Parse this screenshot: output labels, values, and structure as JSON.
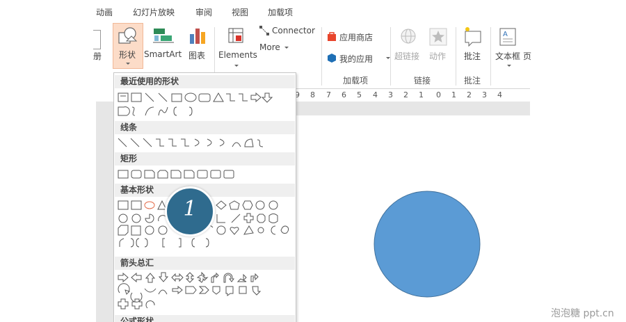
{
  "tabs": [
    "动画",
    "幻灯片放映",
    "审阅",
    "视图",
    "加载项"
  ],
  "ribbon": {
    "edge_label": "册",
    "shapes_button": "形状",
    "smartart_button": "SmartArt",
    "chart_button": "图表",
    "elements_button": "Elements",
    "connector_button": "Connector",
    "more_button": "More",
    "store_button": "应用商店",
    "my_apps_button": "我的应用",
    "addins_group": "加载项",
    "hyperlink_button": "超链接",
    "action_button": "动作",
    "links_group": "链接",
    "comment_button": "批注",
    "comments_group": "批注",
    "textbox_button": "文本框",
    "textbox_trailing": "页"
  },
  "ruler": {
    "labels": [
      "9",
      "8",
      "7",
      "6",
      "5",
      "4",
      "3",
      "2",
      "1",
      "0",
      "1",
      "2",
      "3",
      "4"
    ]
  },
  "shapes_panel": {
    "sections": [
      "最近使用的形状",
      "线条",
      "矩形",
      "基本形状",
      "箭头总汇",
      "公式形状"
    ]
  },
  "callout": {
    "number": "1"
  },
  "canvas": {
    "circle_color": "#5b9bd5",
    "circle_border": "#41719c"
  },
  "watermark": "泡泡糖 ppt.cn"
}
